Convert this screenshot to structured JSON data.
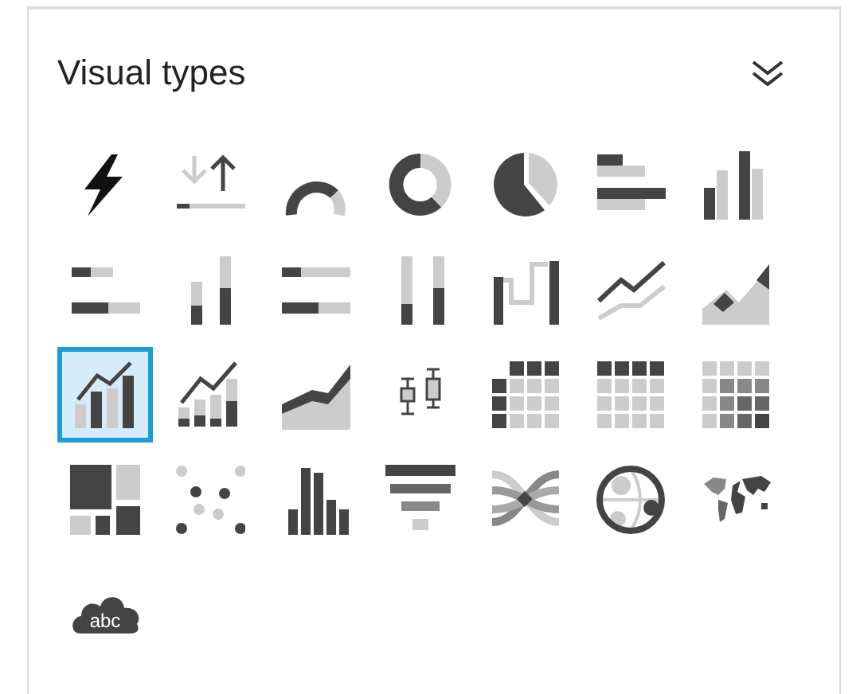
{
  "panel": {
    "title": "Visual types"
  },
  "visuals": [
    {
      "kind": "kpi",
      "selected": false
    },
    {
      "kind": "progress",
      "selected": false
    },
    {
      "kind": "gauge",
      "selected": false
    },
    {
      "kind": "donut",
      "selected": false
    },
    {
      "kind": "pie",
      "selected": false
    },
    {
      "kind": "hbar",
      "selected": false
    },
    {
      "kind": "vbar",
      "selected": false
    },
    {
      "kind": "hbar-stacked",
      "selected": false
    },
    {
      "kind": "vbar-stacked",
      "selected": false
    },
    {
      "kind": "hbar-full",
      "selected": false
    },
    {
      "kind": "vbar-full",
      "selected": false
    },
    {
      "kind": "waterfall",
      "selected": false
    },
    {
      "kind": "line",
      "selected": false
    },
    {
      "kind": "area",
      "selected": false
    },
    {
      "kind": "combo",
      "selected": true
    },
    {
      "kind": "combo-stacked",
      "selected": false
    },
    {
      "kind": "stacked-area",
      "selected": false
    },
    {
      "kind": "boxplot",
      "selected": false
    },
    {
      "kind": "pivot",
      "selected": false
    },
    {
      "kind": "table",
      "selected": false
    },
    {
      "kind": "heatmap",
      "selected": false
    },
    {
      "kind": "treemap",
      "selected": false
    },
    {
      "kind": "scatter",
      "selected": false
    },
    {
      "kind": "histogram",
      "selected": false
    },
    {
      "kind": "funnel",
      "selected": false
    },
    {
      "kind": "sankey",
      "selected": false
    },
    {
      "kind": "geo",
      "selected": false
    },
    {
      "kind": "map",
      "selected": false
    },
    {
      "kind": "wordcloud",
      "selected": false,
      "label": "abc"
    }
  ]
}
